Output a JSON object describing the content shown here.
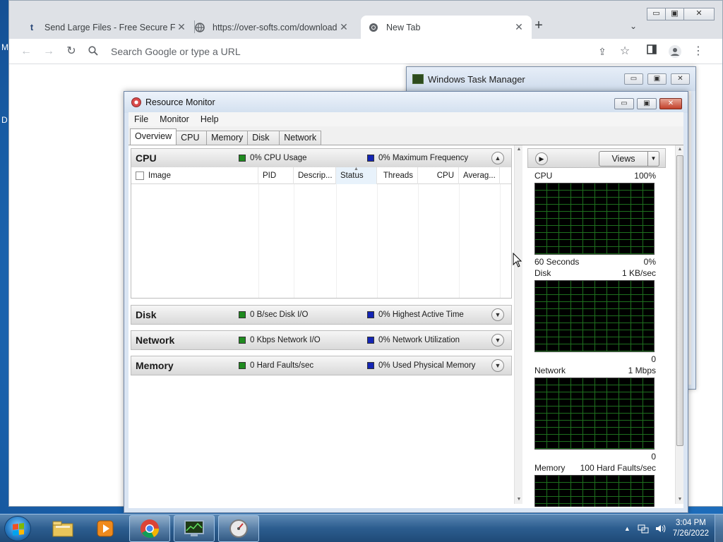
{
  "desktop": {
    "side_letters": [
      "M",
      "D"
    ]
  },
  "browser": {
    "tabs": [
      {
        "title": "Send Large Files - Free Secure Fil",
        "icon": "t-logo-icon"
      },
      {
        "title": "https://over-softs.com/download",
        "icon": "globe-icon"
      },
      {
        "title": "New Tab",
        "icon": "chrome-icon",
        "active": true
      }
    ],
    "new_tab": "+",
    "tab_search": "⌄",
    "omnibox_placeholder": "Search Google or type a URL",
    "window_controls": {
      "minimize": "▭",
      "maximize": "▣",
      "close": "✕"
    }
  },
  "task_manager": {
    "title": "Windows Task Manager",
    "controls": {
      "minimize": "▭",
      "maximize": "▣",
      "close": "✕"
    }
  },
  "resource_monitor": {
    "title": "Resource Monitor",
    "controls": {
      "minimize": "▭",
      "maximize": "▣",
      "close": "✕"
    },
    "menu": [
      "File",
      "Monitor",
      "Help"
    ],
    "tabs": [
      "Overview",
      "CPU",
      "Memory",
      "Disk",
      "Network"
    ],
    "active_tab": "Overview",
    "sections": {
      "cpu": {
        "title": "CPU",
        "legend_green": "0% CPU Usage",
        "legend_blue": "0% Maximum Frequency",
        "columns": [
          "Image",
          "PID",
          "Descrip...",
          "Status",
          "Threads",
          "CPU",
          "Averag..."
        ]
      },
      "disk": {
        "title": "Disk",
        "legend_green": "0 B/sec Disk I/O",
        "legend_blue": "0% Highest Active Time"
      },
      "network": {
        "title": "Network",
        "legend_green": "0 Kbps Network I/O",
        "legend_blue": "0% Network Utilization"
      },
      "memory": {
        "title": "Memory",
        "legend_green": "0 Hard Faults/sec",
        "legend_blue": "0% Used Physical Memory"
      }
    },
    "views_label": "Views",
    "graphs": [
      {
        "label": "CPU",
        "max": "100%",
        "footer_left": "60 Seconds",
        "footer_right": "0%"
      },
      {
        "label": "Disk",
        "max": "1 KB/sec",
        "footer_left": "",
        "footer_right": "0"
      },
      {
        "label": "Network",
        "max": "1 Mbps",
        "footer_left": "",
        "footer_right": "0"
      },
      {
        "label": "Memory",
        "max": "100 Hard Faults/sec",
        "footer_left": "",
        "footer_right": ""
      }
    ]
  },
  "taskbar": {
    "pinned": [
      "windows-explorer-icon",
      "media-player-icon",
      "chrome-icon",
      "task-manager-icon",
      "resource-monitor-icon"
    ],
    "clock_time": "3:04 PM",
    "clock_date": "7/26/2022"
  },
  "colors": {
    "legend_green": "#1f8a1f",
    "legend_blue": "#1425b4",
    "graph_grid": "#1e6f1e"
  }
}
